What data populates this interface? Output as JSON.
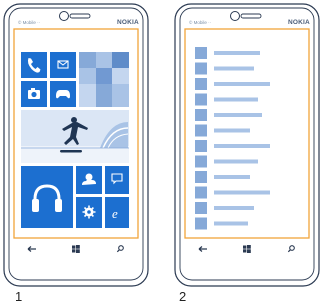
{
  "figure_labels": [
    "1",
    "2"
  ],
  "phones": [
    {
      "operator_text": "© Mobile ··",
      "brand": "NOKIA",
      "screen": "start",
      "tiles": {
        "phone": "phone-icon",
        "messaging": "envelope-icon",
        "camera": "camera-icon",
        "games": "gamepad-icon",
        "music": "headphones-icon",
        "weather": "weather-icon",
        "feedback": "chat-icon",
        "settings": "gear-icon",
        "browser": "internet-explorer-icon"
      },
      "nav": [
        "back-arrow-icon",
        "windows-logo-icon",
        "search-icon"
      ]
    },
    {
      "operator_text": "© Mobile ··",
      "brand": "NOKIA",
      "screen": "app-list",
      "list_rows": 12,
      "nav": [
        "back-arrow-icon",
        "windows-logo-icon",
        "search-icon"
      ]
    }
  ],
  "colors": {
    "accent": "#1c6fd0",
    "tile_light": "#a9c3e6",
    "tile_mid": "#86a9d8",
    "frame": "#2b3a52",
    "screen_border": "#f2a43a",
    "list_text": "#a9c3e6"
  }
}
